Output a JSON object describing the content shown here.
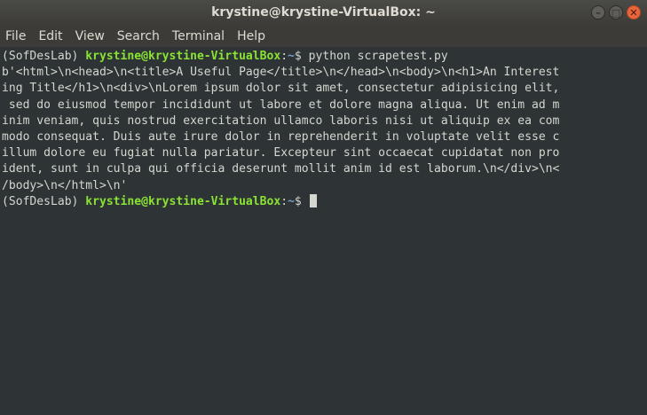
{
  "window": {
    "title": "krystine@krystine-VirtualBox: ~",
    "buttons": {
      "minimize": "–",
      "maximize": "□",
      "close": "✕"
    }
  },
  "menu": [
    "File",
    "Edit",
    "View",
    "Search",
    "Terminal",
    "Help"
  ],
  "terminal": {
    "prompt1": {
      "env": "(SofDesLab) ",
      "userhost": "krystine@krystine-VirtualBox",
      "sep": ":",
      "path": "~",
      "dollar": "$ ",
      "command": "python scrapetest.py"
    },
    "output": [
      "b'<html>\\n<head>\\n<title>A Useful Page</title>\\n</head>\\n<body>\\n<h1>An Interest",
      "ing Title</h1>\\n<div>\\nLorem ipsum dolor sit amet, consectetur adipisicing elit,",
      " sed do eiusmod tempor incididunt ut labore et dolore magna aliqua. Ut enim ad m",
      "inim veniam, quis nostrud exercitation ullamco laboris nisi ut aliquip ex ea com",
      "modo consequat. Duis aute irure dolor in reprehenderit in voluptate velit esse c",
      "illum dolore eu fugiat nulla pariatur. Excepteur sint occaecat cupidatat non pro",
      "ident, sunt in culpa qui officia deserunt mollit anim id est laborum.\\n</div>\\n<",
      "/body>\\n</html>\\n'"
    ],
    "prompt2": {
      "env": "(SofDesLab) ",
      "userhost": "krystine@krystine-VirtualBox",
      "sep": ":",
      "path": "~",
      "dollar": "$ "
    }
  },
  "colors": {
    "background": "#2e3436",
    "foreground": "#d3d7cf",
    "user_host": "#8ae234",
    "path": "#729fcf",
    "titlebar": "#3c3b37",
    "close_button": "#e9643a"
  }
}
